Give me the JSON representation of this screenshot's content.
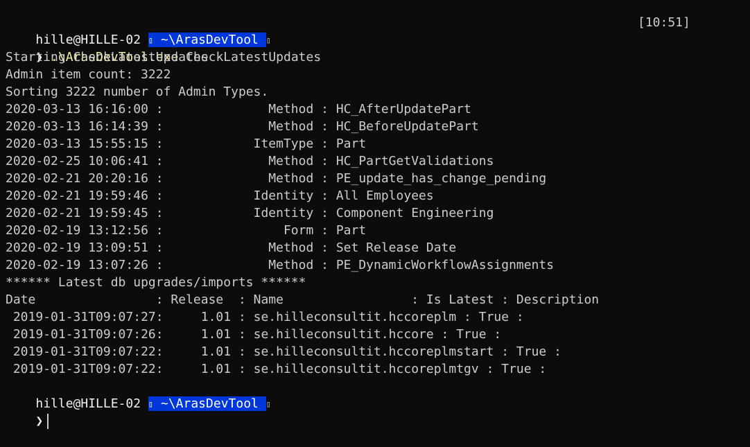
{
  "prompt": {
    "user_host": "hille@HILLE-02",
    "path": "~\\ArasDevTool",
    "glyph_left": "",
    "glyph_right": "",
    "time": "[10:51]",
    "chevron": "❯"
  },
  "command": {
    "exe": ".\\ArasDevTool.exe",
    "arg": " CheckLatestUpdates"
  },
  "output_lines": [
    "Starting CheckLatestUpdates",
    "Admin item count: 3222",
    "Sorting 3222 number of Admin Types.",
    "2020-03-13 16:16:00 :              Method : HC_AfterUpdatePart",
    "2020-03-13 16:14:39 :              Method : HC_BeforeUpdatePart",
    "2020-03-13 15:55:15 :            ItemType : Part",
    "2020-02-25 10:06:41 :              Method : HC_PartGetValidations",
    "2020-02-21 20:20:16 :              Method : PE_update_has_change_pending",
    "2020-02-21 19:59:46 :            Identity : All Employees",
    "2020-02-21 19:59:45 :            Identity : Component Engineering",
    "2020-02-19 13:12:56 :                Form : Part",
    "2020-02-19 13:09:51 :              Method : Set Release Date",
    "2020-02-19 13:07:26 :              Method : PE_DynamicWorkflowAssignments",
    "****** Latest db upgrades/imports ******",
    "Date                : Release  : Name                 : Is Latest : Description",
    " 2019-01-31T09:07:27:     1.01 : se.hilleconsultit.hccoreplm : True :",
    " 2019-01-31T09:07:26:     1.01 : se.hilleconsultit.hccore : True :",
    " 2019-01-31T09:07:22:     1.01 : se.hilleconsultit.hccoreplmstart : True :",
    " 2019-01-31T09:07:22:     1.01 : se.hilleconsultit.hccoreplmtgv : True :"
  ],
  "colors": {
    "background": "#0c0c0c",
    "text": "#cccccc",
    "path_bg": "#0037da",
    "exe": "#f9f1a5"
  }
}
